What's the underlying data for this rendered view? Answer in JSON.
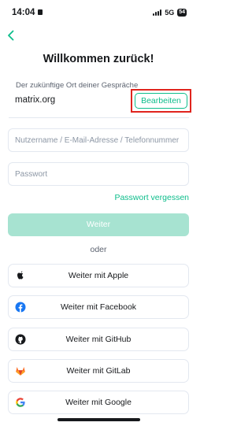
{
  "status_bar": {
    "time": "14:04",
    "network": "5G",
    "battery": "54"
  },
  "header": {
    "back_icon": "chevron-left-icon",
    "title": "Willkommen zurück!"
  },
  "server": {
    "caption": "Der zukünftige Ort deiner Gespräche",
    "name": "matrix.org",
    "edit_label": "Bearbeiten"
  },
  "form": {
    "username_placeholder": "Nutzername / E-Mail-Adresse / Telefonnummer",
    "password_placeholder": "Passwort",
    "forgot_password": "Passwort vergessen",
    "continue_label": "Weiter"
  },
  "separator": "oder",
  "sso": [
    {
      "label": "Weiter mit Apple",
      "icon": "apple-icon"
    },
    {
      "label": "Weiter mit Facebook",
      "icon": "facebook-icon"
    },
    {
      "label": "Weiter mit GitHub",
      "icon": "github-icon"
    },
    {
      "label": "Weiter mit GitLab",
      "icon": "gitlab-icon"
    },
    {
      "label": "Weiter mit Google",
      "icon": "google-icon"
    }
  ],
  "colors": {
    "accent": "#0dbd8b",
    "accent_disabled": "#a7e3d1",
    "highlight": "#e0241e",
    "text": "#17191c",
    "secondary_text": "#5c6370",
    "border": "#e3e8f0"
  }
}
